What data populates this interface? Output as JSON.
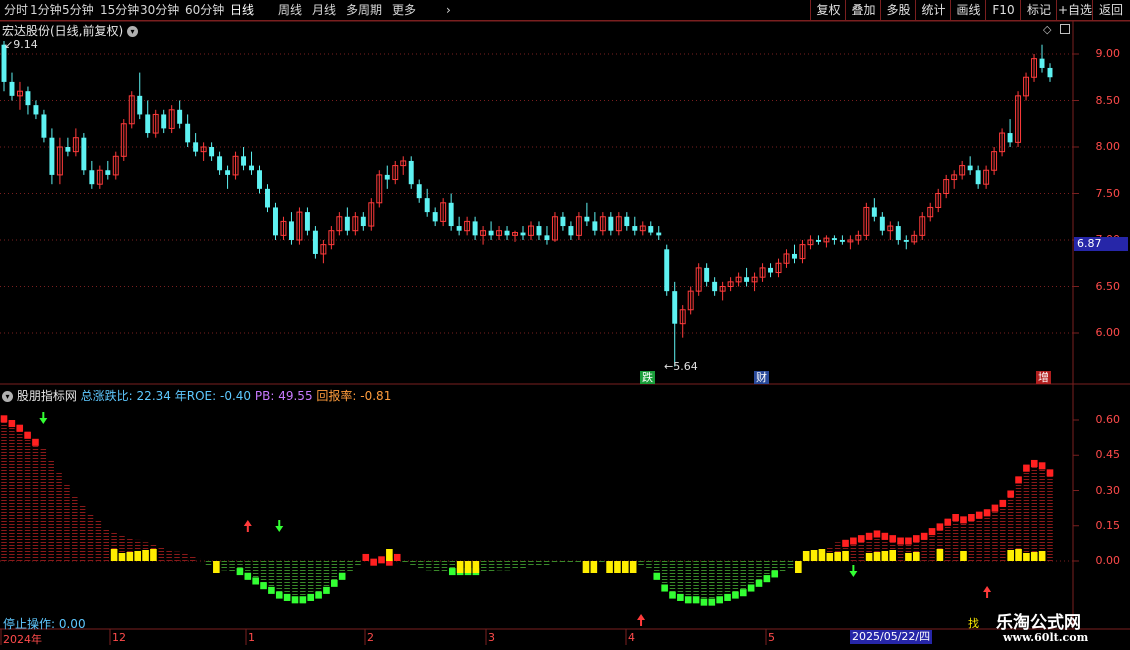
{
  "toolbar": {
    "periods": [
      "分时",
      "1分钟",
      "5分钟",
      "15分钟",
      "30分钟",
      "60分钟",
      "日线",
      "周线",
      "月线",
      "多周期",
      "更多"
    ],
    "active_period": "日线",
    "more_icon": "chevron-right-icon",
    "buttons": [
      "复权",
      "叠加",
      "多股",
      "统计",
      "画线",
      "F10",
      "标记",
      "+自选",
      "返回"
    ]
  },
  "main_chart": {
    "title": "宏达股份(日线,前复权)",
    "high_label": "9.14",
    "low_label": "5.64",
    "current_price": "6.87",
    "y_ticks": [
      "9.00",
      "8.50",
      "8.00",
      "7.50",
      "7.00",
      "6.50",
      "6.00"
    ],
    "event_badges": [
      {
        "text": "跌",
        "color": "#1a9e3a",
        "x_date": "2025-04-07"
      },
      {
        "text": "财",
        "color": "#2a4a9a",
        "x_date": "2025-04-30"
      },
      {
        "text": "增",
        "color": "#b01f1f",
        "x_date": "2025-05-22"
      }
    ],
    "icons": [
      "diamond-icon",
      "window-icon"
    ]
  },
  "indicator": {
    "name": "股朋指标网",
    "stats": [
      {
        "label": "总涨跌比:",
        "value": "22.34",
        "color": "#5ec8ff"
      },
      {
        "label": "年ROE:",
        "value": "-0.40",
        "color": "#5ec8ff"
      },
      {
        "label": "PB:",
        "value": "49.55",
        "color": "#c87aff"
      },
      {
        "label": "回报率:",
        "value": "-0.81",
        "color": "#ff9c3c"
      }
    ],
    "y_ticks": [
      "0.60",
      "0.45",
      "0.30",
      "0.15",
      "0.00"
    ],
    "status": "停止操作: 0.00",
    "corner_label": "找"
  },
  "x_axis": {
    "labels": [
      "2024年",
      "12",
      "1",
      "2",
      "3",
      "4",
      "5"
    ],
    "cursor_date": "2025/05/22/四"
  },
  "watermark": {
    "title": "乐淘公式网",
    "url": "www.60lt.com"
  },
  "colors": {
    "up": "#ff3b3b",
    "down": "#5ef2f2",
    "grid": "#7a1f1f",
    "axis_text": "#ff4b4b"
  },
  "chart_data": {
    "type": "candlestick",
    "candles": [
      [
        9.1,
        9.14,
        8.6,
        8.7
      ],
      [
        8.7,
        8.8,
        8.5,
        8.55
      ],
      [
        8.55,
        8.7,
        8.4,
        8.6
      ],
      [
        8.6,
        8.65,
        8.35,
        8.45
      ],
      [
        8.45,
        8.5,
        8.3,
        8.35
      ],
      [
        8.35,
        8.4,
        8.05,
        8.1
      ],
      [
        8.1,
        8.2,
        7.6,
        7.7
      ],
      [
        7.7,
        8.1,
        7.6,
        8.0
      ],
      [
        8.0,
        8.1,
        7.9,
        7.95
      ],
      [
        7.95,
        8.2,
        7.9,
        8.1
      ],
      [
        8.1,
        8.15,
        7.7,
        7.75
      ],
      [
        7.75,
        7.85,
        7.55,
        7.6
      ],
      [
        7.6,
        7.8,
        7.55,
        7.75
      ],
      [
        7.75,
        7.85,
        7.65,
        7.7
      ],
      [
        7.7,
        7.95,
        7.65,
        7.9
      ],
      [
        7.9,
        8.3,
        7.85,
        8.25
      ],
      [
        8.25,
        8.6,
        8.2,
        8.55
      ],
      [
        8.55,
        8.8,
        8.3,
        8.35
      ],
      [
        8.35,
        8.5,
        8.1,
        8.15
      ],
      [
        8.15,
        8.4,
        8.1,
        8.35
      ],
      [
        8.35,
        8.4,
        8.15,
        8.2
      ],
      [
        8.2,
        8.45,
        8.15,
        8.4
      ],
      [
        8.4,
        8.5,
        8.2,
        8.25
      ],
      [
        8.25,
        8.35,
        8.0,
        8.05
      ],
      [
        8.05,
        8.15,
        7.9,
        7.95
      ],
      [
        7.95,
        8.05,
        7.85,
        8.0
      ],
      [
        8.0,
        8.05,
        7.85,
        7.9
      ],
      [
        7.9,
        7.95,
        7.7,
        7.75
      ],
      [
        7.75,
        7.8,
        7.55,
        7.7
      ],
      [
        7.7,
        7.95,
        7.65,
        7.9
      ],
      [
        7.9,
        8.0,
        7.75,
        7.8
      ],
      [
        7.8,
        7.95,
        7.7,
        7.75
      ],
      [
        7.75,
        7.8,
        7.5,
        7.55
      ],
      [
        7.55,
        7.6,
        7.3,
        7.35
      ],
      [
        7.35,
        7.4,
        7.0,
        7.05
      ],
      [
        7.05,
        7.25,
        7.0,
        7.2
      ],
      [
        7.2,
        7.3,
        6.95,
        7.0
      ],
      [
        7.0,
        7.35,
        6.95,
        7.3
      ],
      [
        7.3,
        7.35,
        7.05,
        7.1
      ],
      [
        7.1,
        7.15,
        6.8,
        6.85
      ],
      [
        6.85,
        7.0,
        6.75,
        6.95
      ],
      [
        6.95,
        7.15,
        6.9,
        7.1
      ],
      [
        7.1,
        7.3,
        7.05,
        7.25
      ],
      [
        7.25,
        7.35,
        7.05,
        7.1
      ],
      [
        7.1,
        7.3,
        7.05,
        7.25
      ],
      [
        7.25,
        7.3,
        7.1,
        7.15
      ],
      [
        7.15,
        7.45,
        7.1,
        7.4
      ],
      [
        7.4,
        7.75,
        7.35,
        7.7
      ],
      [
        7.7,
        7.8,
        7.55,
        7.65
      ],
      [
        7.65,
        7.85,
        7.6,
        7.8
      ],
      [
        7.8,
        7.9,
        7.7,
        7.85
      ],
      [
        7.85,
        7.9,
        7.55,
        7.6
      ],
      [
        7.6,
        7.65,
        7.4,
        7.45
      ],
      [
        7.45,
        7.55,
        7.25,
        7.3
      ],
      [
        7.3,
        7.35,
        7.15,
        7.2
      ],
      [
        7.2,
        7.45,
        7.15,
        7.4
      ],
      [
        7.4,
        7.5,
        7.1,
        7.15
      ],
      [
        7.15,
        7.25,
        7.05,
        7.1
      ],
      [
        7.1,
        7.25,
        7.05,
        7.2
      ],
      [
        7.2,
        7.25,
        7.0,
        7.05
      ],
      [
        7.05,
        7.15,
        6.95,
        7.1
      ],
      [
        7.1,
        7.2,
        7.0,
        7.05
      ],
      [
        7.05,
        7.15,
        7.0,
        7.1
      ],
      [
        7.1,
        7.15,
        7.0,
        7.05
      ],
      [
        7.05,
        7.1,
        6.98,
        7.08
      ],
      [
        7.08,
        7.15,
        7.0,
        7.05
      ],
      [
        7.05,
        7.2,
        7.0,
        7.15
      ],
      [
        7.15,
        7.2,
        7.0,
        7.05
      ],
      [
        7.05,
        7.15,
        6.95,
        7.0
      ],
      [
        7.0,
        7.3,
        6.98,
        7.25
      ],
      [
        7.25,
        7.3,
        7.1,
        7.15
      ],
      [
        7.15,
        7.2,
        7.0,
        7.05
      ],
      [
        7.05,
        7.3,
        7.0,
        7.25
      ],
      [
        7.25,
        7.4,
        7.15,
        7.2
      ],
      [
        7.2,
        7.3,
        7.05,
        7.1
      ],
      [
        7.1,
        7.3,
        7.05,
        7.25
      ],
      [
        7.25,
        7.3,
        7.05,
        7.1
      ],
      [
        7.1,
        7.3,
        7.05,
        7.25
      ],
      [
        7.25,
        7.3,
        7.1,
        7.15
      ],
      [
        7.15,
        7.25,
        7.05,
        7.1
      ],
      [
        7.1,
        7.2,
        7.05,
        7.15
      ],
      [
        7.15,
        7.2,
        7.05,
        7.08
      ],
      [
        7.08,
        7.15,
        7.0,
        7.05
      ],
      [
        6.9,
        6.95,
        6.4,
        6.45
      ],
      [
        6.45,
        6.55,
        5.64,
        6.1
      ],
      [
        6.1,
        6.3,
        5.95,
        6.25
      ],
      [
        6.25,
        6.5,
        6.2,
        6.45
      ],
      [
        6.45,
        6.75,
        6.4,
        6.7
      ],
      [
        6.7,
        6.75,
        6.5,
        6.55
      ],
      [
        6.55,
        6.6,
        6.4,
        6.45
      ],
      [
        6.45,
        6.55,
        6.35,
        6.5
      ],
      [
        6.5,
        6.6,
        6.45,
        6.55
      ],
      [
        6.55,
        6.65,
        6.5,
        6.6
      ],
      [
        6.6,
        6.7,
        6.5,
        6.55
      ],
      [
        6.55,
        6.65,
        6.45,
        6.6
      ],
      [
        6.6,
        6.75,
        6.55,
        6.7
      ],
      [
        6.7,
        6.75,
        6.6,
        6.65
      ],
      [
        6.65,
        6.8,
        6.6,
        6.75
      ],
      [
        6.75,
        6.9,
        6.7,
        6.85
      ],
      [
        6.85,
        6.95,
        6.75,
        6.8
      ],
      [
        6.8,
        7.0,
        6.75,
        6.95
      ],
      [
        6.95,
        7.05,
        6.9,
        7.0
      ],
      [
        7.0,
        7.05,
        6.95,
        6.98
      ],
      [
        6.98,
        7.05,
        6.92,
        7.02
      ],
      [
        7.02,
        7.05,
        6.95,
        7.0
      ],
      [
        7.0,
        7.05,
        6.95,
        6.98
      ],
      [
        6.98,
        7.05,
        6.9,
        7.0
      ],
      [
        7.0,
        7.1,
        6.95,
        7.05
      ],
      [
        7.05,
        7.4,
        7.0,
        7.35
      ],
      [
        7.35,
        7.45,
        7.2,
        7.25
      ],
      [
        7.25,
        7.3,
        7.05,
        7.1
      ],
      [
        7.1,
        7.2,
        7.0,
        7.15
      ],
      [
        7.15,
        7.2,
        6.95,
        7.0
      ],
      [
        7.0,
        7.05,
        6.9,
        6.98
      ],
      [
        6.98,
        7.1,
        6.95,
        7.05
      ],
      [
        7.05,
        7.3,
        7.0,
        7.25
      ],
      [
        7.25,
        7.4,
        7.2,
        7.35
      ],
      [
        7.35,
        7.55,
        7.3,
        7.5
      ],
      [
        7.5,
        7.7,
        7.45,
        7.65
      ],
      [
        7.65,
        7.75,
        7.55,
        7.7
      ],
      [
        7.7,
        7.85,
        7.65,
        7.8
      ],
      [
        7.8,
        7.9,
        7.7,
        7.75
      ],
      [
        7.75,
        7.8,
        7.55,
        7.6
      ],
      [
        7.6,
        7.8,
        7.55,
        7.75
      ],
      [
        7.75,
        8.0,
        7.7,
        7.95
      ],
      [
        7.95,
        8.2,
        7.9,
        8.15
      ],
      [
        8.15,
        8.3,
        8.0,
        8.05
      ],
      [
        8.05,
        8.6,
        8.0,
        8.55
      ],
      [
        8.55,
        8.8,
        8.5,
        8.75
      ],
      [
        8.75,
        9.0,
        8.7,
        8.95
      ],
      [
        8.95,
        9.1,
        8.8,
        8.85
      ],
      [
        8.85,
        8.9,
        8.7,
        8.75
      ]
    ],
    "indicator_bars_note": "histogram of indicator value per candle",
    "indicator_values": [
      0.62,
      0.6,
      0.58,
      0.55,
      0.52,
      0.48,
      0.43,
      0.38,
      0.33,
      0.28,
      0.24,
      0.2,
      0.17,
      0.14,
      0.12,
      0.11,
      0.1,
      0.09,
      0.08,
      0.07,
      0.06,
      0.05,
      0.04,
      0.03,
      0.02,
      0.0,
      -0.02,
      -0.03,
      -0.04,
      -0.05,
      -0.06,
      -0.08,
      -0.1,
      -0.12,
      -0.14,
      -0.16,
      -0.17,
      -0.18,
      -0.18,
      -0.17,
      -0.16,
      -0.14,
      -0.11,
      -0.08,
      -0.05,
      -0.02,
      0.0,
      0.01,
      0.02,
      0.01,
      0.0,
      -0.01,
      -0.02,
      -0.03,
      -0.04,
      -0.05,
      -0.05,
      -0.06,
      -0.06,
      -0.06,
      -0.06,
      -0.05,
      -0.05,
      -0.04,
      -0.04,
      -0.03,
      -0.03,
      -0.02,
      -0.02,
      -0.02,
      -0.01,
      -0.01,
      -0.01,
      -0.01,
      -0.01,
      -0.01,
      -0.01,
      -0.01,
      -0.01,
      -0.01,
      -0.01,
      -0.02,
      -0.03,
      -0.08,
      -0.13,
      -0.16,
      -0.17,
      -0.18,
      -0.18,
      -0.19,
      -0.19,
      -0.18,
      -0.17,
      -0.16,
      -0.15,
      -0.13,
      -0.11,
      -0.09,
      -0.07,
      -0.05,
      -0.03,
      -0.01,
      0.01,
      0.03,
      0.05,
      0.06,
      0.08,
      0.09,
      0.1,
      0.11,
      0.12,
      0.13,
      0.12,
      0.11,
      0.1,
      0.1,
      0.11,
      0.12,
      0.14,
      0.16,
      0.18,
      0.2,
      0.19,
      0.2,
      0.21,
      0.22,
      0.24,
      0.26,
      0.3,
      0.36,
      0.41,
      0.43,
      0.42,
      0.39
    ],
    "indicator_ylim": [
      -0.28,
      0.68
    ],
    "price_ylim": [
      5.5,
      9.3
    ],
    "volume_markers": [
      {
        "idx": 3,
        "color": "#ffee00",
        "value": 0.07
      },
      {
        "idx": 4,
        "color": "#ffee00",
        "value": 0.05
      },
      {
        "idx": 5,
        "color": "#ffee00",
        "value": 0.05
      }
    ]
  }
}
